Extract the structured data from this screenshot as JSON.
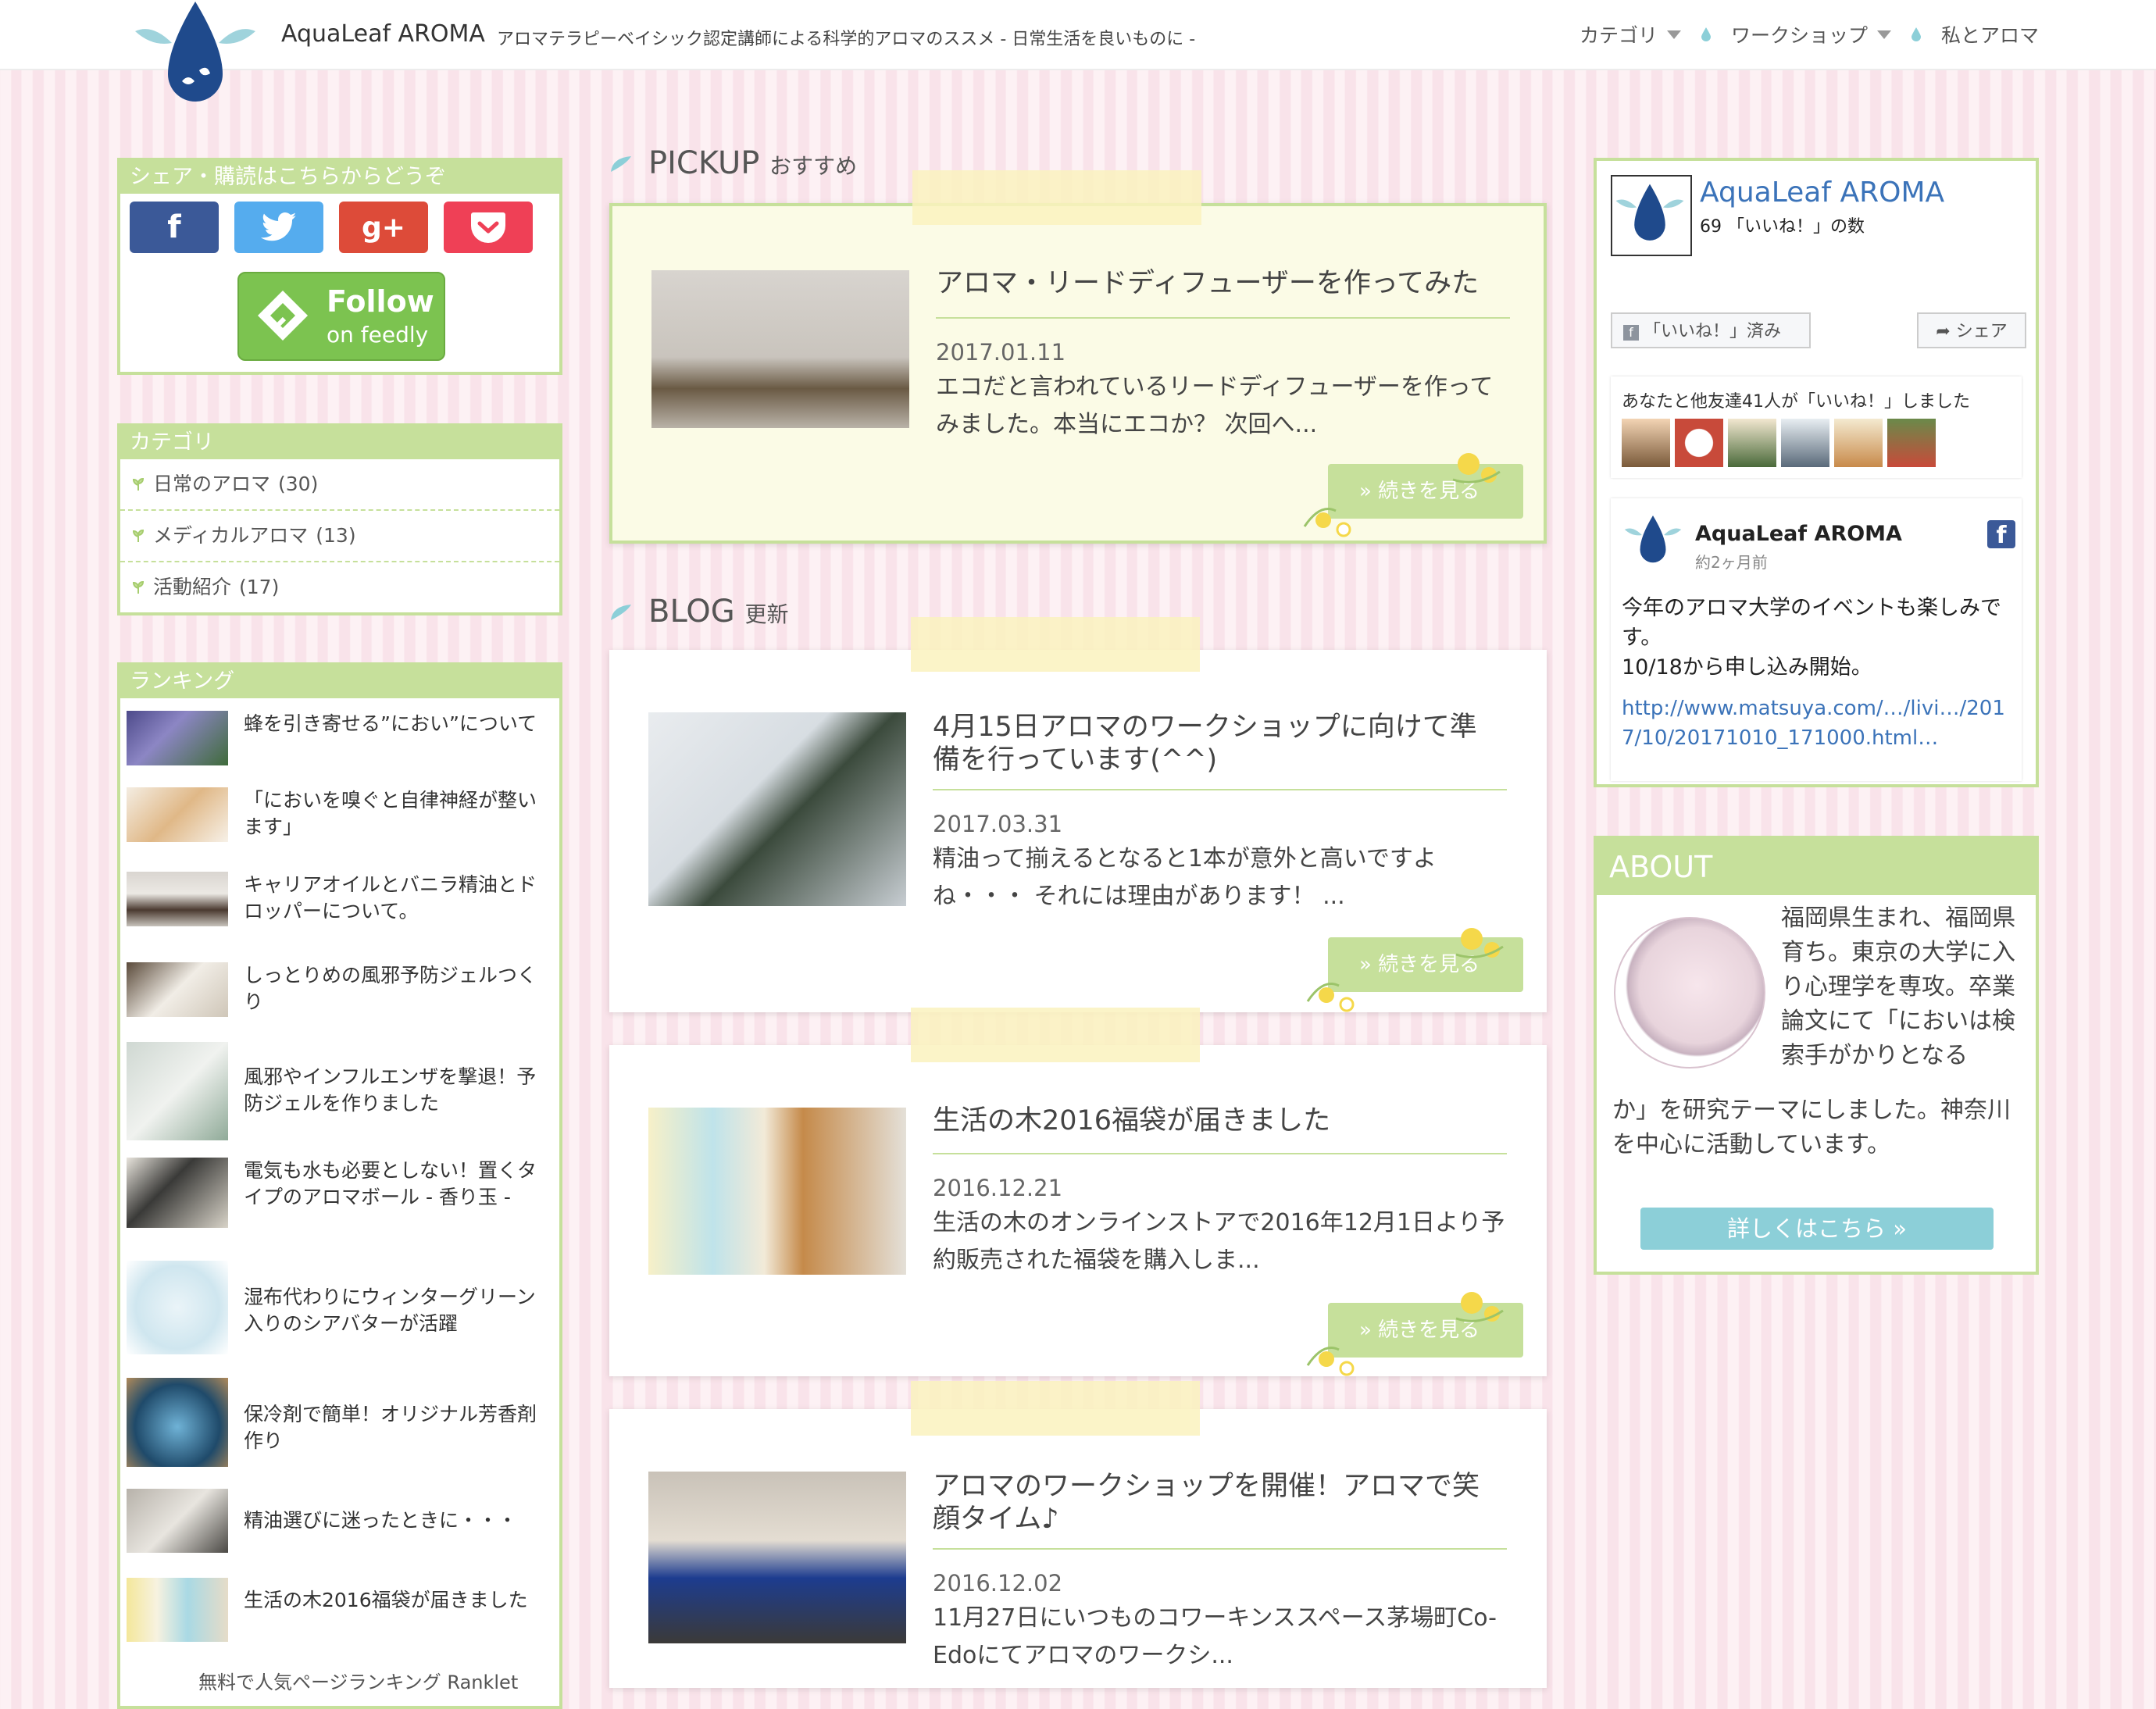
{
  "header": {
    "site_title": "AquaLeaf AROMA",
    "tagline": "アロマテラピーベイシック認定講師による科学的アロマのススメ - 日常生活を良いものに -",
    "nav": [
      {
        "label": "カテゴリ",
        "has_dropdown": true
      },
      {
        "label": "ワークショップ",
        "has_dropdown": true
      },
      {
        "label": "私とアロマ",
        "has_dropdown": false
      }
    ]
  },
  "share_box": {
    "heading": "シェア・購読はこちらからどうぞ",
    "buttons": [
      {
        "icon": "facebook-icon",
        "glyph": "f",
        "color": "#3b5998"
      },
      {
        "icon": "twitter-icon",
        "glyph": "t",
        "color": "#55acee"
      },
      {
        "icon": "googleplus-icon",
        "glyph": "g+",
        "color": "#dd4b39"
      },
      {
        "icon": "pocket-icon",
        "glyph": "p",
        "color": "#ef4056"
      }
    ],
    "feedly": {
      "line1": "Follow",
      "line2": "on feedly"
    }
  },
  "category_box": {
    "heading": "カテゴリ",
    "items": [
      {
        "label": "日常のアロマ",
        "count": "(30)"
      },
      {
        "label": "メディカルアロマ",
        "count": "(13)"
      },
      {
        "label": "活動紹介",
        "count": "(17)"
      }
    ]
  },
  "ranking_box": {
    "heading": "ランキング",
    "items": [
      "蜂を引き寄せる”におい”について",
      "「においを嗅ぐと自律神経が整います」",
      "キャリアオイルとバニラ精油とドロッパーについて。",
      "しっとりめの風邪予防ジェルつくり",
      "風邪やインフルエンザを撃退！予防ジェルを作りました",
      "電気も水も必要としない！置くタイプのアロマボール - 香り玉 -",
      "湿布代わりにウィンターグリーン入りのシアバターが活躍",
      "保冷剤で簡単！オリジナル芳香剤作り",
      "精油選びに迷ったときに・・・",
      "生活の木2016福袋が届きました"
    ],
    "footer": "無料で人気ページランキング Ranklet"
  },
  "pickup": {
    "heading": "PICKUP",
    "heading_sub": "おすすめ",
    "title": "アロマ・リードディフューザーを作ってみた",
    "date": "2017.01.11",
    "excerpt": "エコだと言われているリードディフューザーを作ってみました。本当にエコか？ 次回へ...",
    "more": "» 続きを見る"
  },
  "blog": {
    "heading": "BLOG",
    "heading_sub": "更新",
    "posts": [
      {
        "title": "4月15日アロマのワークショップに向けて準備を行っています(^^)",
        "date": "2017.03.31",
        "excerpt": "精油って揃えるとなると1本が意外と高いですよね・・・ それには理由があります！ ...",
        "more": "» 続きを見る"
      },
      {
        "title": "生活の木2016福袋が届きました",
        "date": "2016.12.21",
        "excerpt": "生活の木のオンラインストアで2016年12月1日より予約販売された福袋を購入しま...",
        "more": "» 続きを見る"
      },
      {
        "title": "アロマのワークショップを開催！アロマで笑顔タイム♪",
        "date": "2016.12.02",
        "excerpt": "11月27日にいつものコワーキンススペース茅場町Co-Edoにてアロマのワークシ...",
        "more": "» 続きを見る"
      }
    ]
  },
  "facebook_box": {
    "page_name": "AquaLeaf AROMA",
    "likes_count": "69",
    "likes_label": "「いいね！」の数",
    "liked_button": "「いいね！」済み",
    "share_button": "シェア",
    "friends_text": "あなたと他友達41人が「いいね！」しました",
    "post": {
      "author": "AquaLeaf AROMA",
      "time": "約2ヶ月前",
      "body_line1": "今年のアロマ大学のイベントも楽しみです。",
      "body_line2": "10/18から申し込み開始。",
      "link": "http://www.matsuya.com/…/livi…/2017/10/20171010_171000.html…"
    }
  },
  "about_box": {
    "heading": "ABOUT",
    "text_right": "福岡県生まれ、福岡県育ち。東京の大学に入り心理学を専攻。卒業論文にて「においは検索手がかりとなる",
    "text_full": "か」を研究テーマにしました。神奈川を中心に活動しています。",
    "button": "詳しくはこちら »"
  },
  "colors": {
    "accent_green": "#c6e09b",
    "about_button": "#8ccfd8",
    "facebook_blue": "#3b5998",
    "drop_blue": "#1f4a8c"
  }
}
